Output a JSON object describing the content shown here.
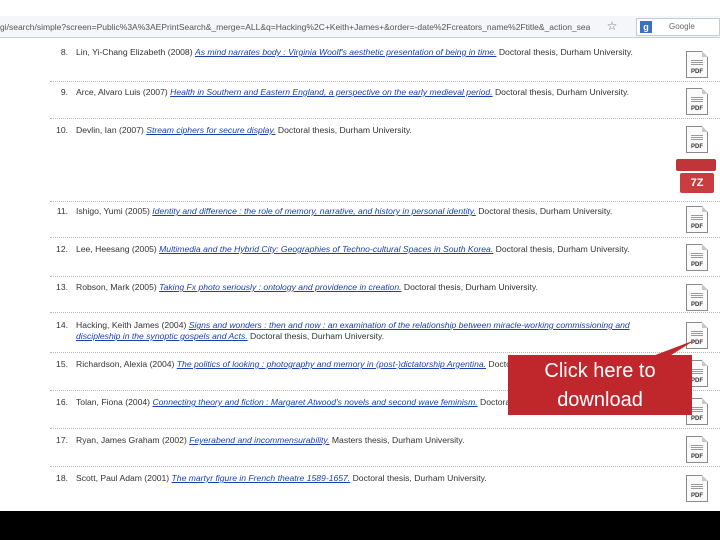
{
  "url_bar": {
    "url": "gi/search/simple?screen=Public%3A%3AEPrintSearch&_merge=ALL&q=Hacking%2C+Keith+James+&order=-date%2Fcreators_name%2Ftitle&_action_search=Search",
    "search_engine": "Google"
  },
  "results": [
    {
      "num": "8.",
      "author": "Lin, Yi-Chang Elizabeth (2008)",
      "title": "As mind narrates body : Virginia Woolf's aesthetic presentation of being in time.",
      "type": "Doctoral thesis, Durham University."
    },
    {
      "num": "9.",
      "author": "Arce, Alvaro Luis (2007)",
      "title": "Health in Southern and Eastern England, a perspective on the early medieval period.",
      "type": "Doctoral thesis, Durham University."
    },
    {
      "num": "10.",
      "author": "Devlin, Ian (2007)",
      "title": "Stream ciphers for secure display.",
      "type": "Doctoral thesis, Durham University."
    },
    {
      "num": "11.",
      "author": "Ishigo, Yumi (2005)",
      "title": "Identity and difference : the role of memory, narrative, and history in personal identity.",
      "type": "Doctoral thesis, Durham University."
    },
    {
      "num": "12.",
      "author": "Lee, Heesang (2005)",
      "title": "Multimedia and the Hybrid City: Geographies of Techno-cultural Spaces in South Korea.",
      "type": "Doctoral thesis, Durham University."
    },
    {
      "num": "13.",
      "author": "Robson, Mark (2005)",
      "title": "Taking Fx photo seriously : ontology and providence in creation.",
      "type": "Doctoral thesis, Durham University."
    },
    {
      "num": "14.",
      "author": "Hacking, Keith James (2004)",
      "title": "Signs and wonders : then and now : an examination of the relationship between miracle-working commissioning and discipleship in the synoptic gospels and Acts.",
      "type": "Doctoral thesis, Durham University."
    },
    {
      "num": "15.",
      "author": "Richardson, Alexia (2004)",
      "title": "The politics of looking : photography and memory in (post-)dictatorship Argentina.",
      "type": "Doctoral thesis, Durham University."
    },
    {
      "num": "16.",
      "author": "Tolan, Fiona (2004)",
      "title": "Connecting theory and fiction : Margaret Atwood's novels and second wave feminism.",
      "type": "Doctoral thesis, Durham University."
    },
    {
      "num": "17.",
      "author": "Ryan, James Graham (2002)",
      "title": "Feyerabend and incommensurability.",
      "type": "Masters thesis, Durham University."
    },
    {
      "num": "18.",
      "author": "Scott, Paul Adam (2001)",
      "title": "The martyr figure in French theatre 1589-1657.",
      "type": "Doctoral thesis, Durham University."
    }
  ],
  "pdf_label": "PDF",
  "zip_label": "7Z",
  "callout": {
    "line1": "Click here to",
    "line2": "download"
  },
  "colors": {
    "callout": "#c0272d",
    "link": "#1a3fb0"
  }
}
